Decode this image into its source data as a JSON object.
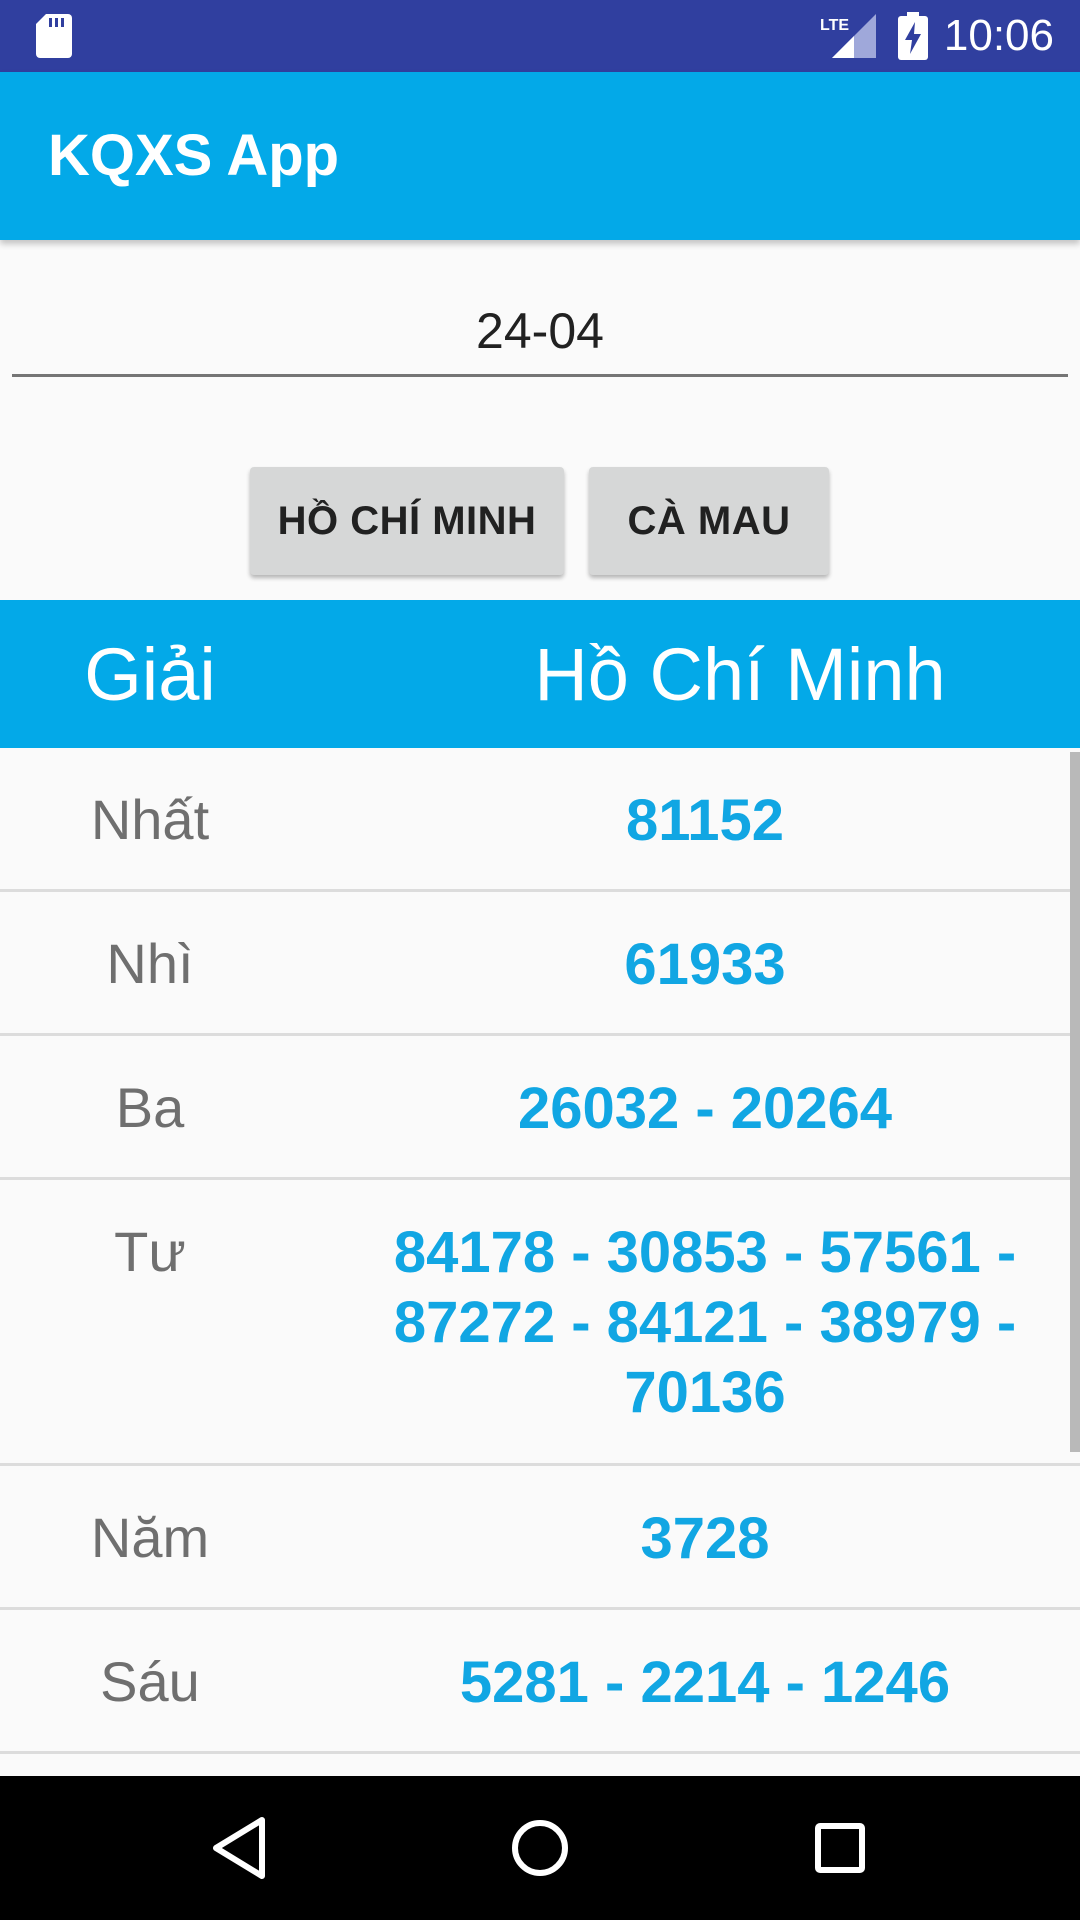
{
  "status_bar": {
    "time": "10:06",
    "network": "LTE",
    "icons": [
      "sd-card-icon",
      "lte-signal-icon",
      "battery-charging-icon"
    ]
  },
  "app_bar": {
    "title": "KQXS App"
  },
  "date_input": {
    "value": "24-04"
  },
  "buttons": {
    "ho_chi_minh": "HỒ CHÍ MINH",
    "ca_mau": "CÀ MAU"
  },
  "table": {
    "header_prize": "Giải",
    "header_city": "Hồ Chí Minh",
    "rows": [
      {
        "prize": "Nhất",
        "value": "81152"
      },
      {
        "prize": "Nhì",
        "value": "61933"
      },
      {
        "prize": "Ba",
        "value": "26032 - 20264"
      },
      {
        "prize": "Tư",
        "value": "84178 - 30853 - 57561 - 87272 - 84121 - 38979 - 70136"
      },
      {
        "prize": "Năm",
        "value": "3728"
      },
      {
        "prize": "Sáu",
        "value": "5281 - 2214 - 1246"
      }
    ]
  },
  "colors": {
    "status_bar": "#303f9f",
    "primary": "#03a9e8",
    "number": "#11a6e3",
    "button": "#d6d7d7"
  },
  "nav_bar": {
    "icons": [
      "back-icon",
      "home-icon",
      "recents-icon"
    ]
  }
}
